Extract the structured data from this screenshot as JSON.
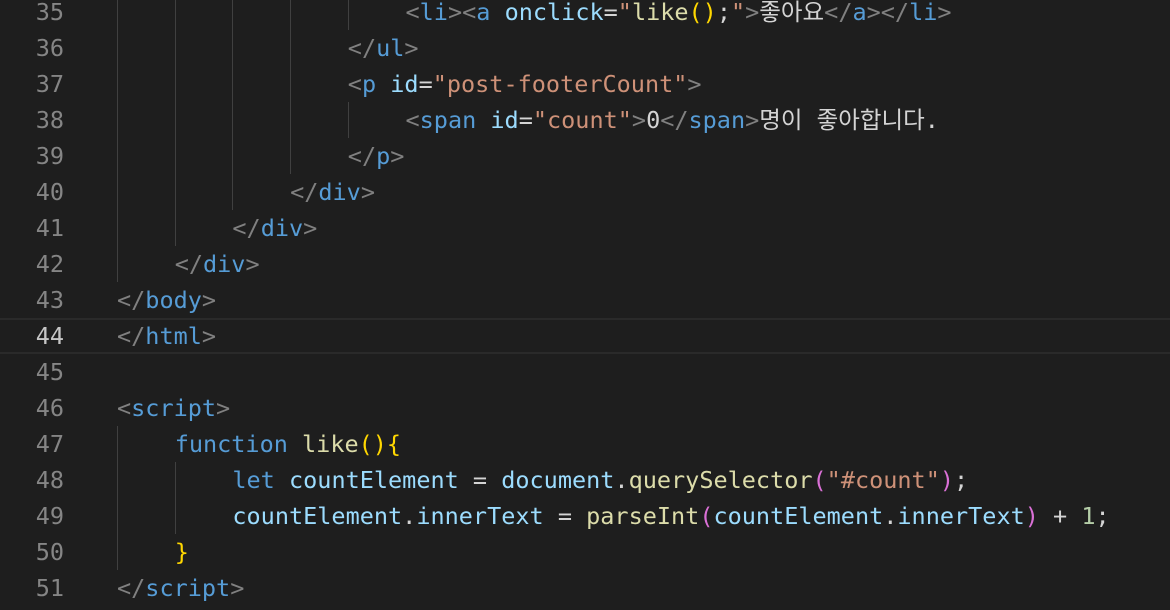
{
  "editor": {
    "current_line": 44,
    "lines": [
      {
        "n": "35",
        "indent": 5,
        "tokens": [
          [
            "<",
            "punc"
          ],
          [
            "li",
            "tag"
          ],
          [
            ">",
            "punc"
          ],
          [
            "<",
            "punc"
          ],
          [
            "a",
            "tag"
          ],
          [
            " ",
            "text"
          ],
          [
            "onclick",
            "attr"
          ],
          [
            "=",
            "text"
          ],
          [
            "\"",
            "str"
          ],
          [
            "like",
            "fn"
          ],
          [
            "()",
            "br1"
          ],
          [
            ";",
            "text"
          ],
          [
            "\"",
            "str"
          ],
          [
            ">",
            "punc"
          ],
          [
            "좋아요",
            "text"
          ],
          [
            "</",
            "punc"
          ],
          [
            "a",
            "tag"
          ],
          [
            ">",
            "punc"
          ],
          [
            "</",
            "punc"
          ],
          [
            "li",
            "tag"
          ],
          [
            ">",
            "punc"
          ]
        ]
      },
      {
        "n": "36",
        "indent": 4,
        "tokens": [
          [
            "</",
            "punc"
          ],
          [
            "ul",
            "tag"
          ],
          [
            ">",
            "punc"
          ]
        ]
      },
      {
        "n": "37",
        "indent": 4,
        "tokens": [
          [
            "<",
            "punc"
          ],
          [
            "p",
            "tag"
          ],
          [
            " ",
            "text"
          ],
          [
            "id",
            "attr"
          ],
          [
            "=",
            "text"
          ],
          [
            "\"post-footerCount\"",
            "str"
          ],
          [
            ">",
            "punc"
          ]
        ]
      },
      {
        "n": "38",
        "indent": 5,
        "tokens": [
          [
            "<",
            "punc"
          ],
          [
            "span",
            "tag"
          ],
          [
            " ",
            "text"
          ],
          [
            "id",
            "attr"
          ],
          [
            "=",
            "text"
          ],
          [
            "\"count\"",
            "str"
          ],
          [
            ">",
            "punc"
          ],
          [
            "0",
            "text"
          ],
          [
            "</",
            "punc"
          ],
          [
            "span",
            "tag"
          ],
          [
            ">",
            "punc"
          ],
          [
            "명이 좋아합니다.",
            "text"
          ]
        ]
      },
      {
        "n": "39",
        "indent": 4,
        "tokens": [
          [
            "</",
            "punc"
          ],
          [
            "p",
            "tag"
          ],
          [
            ">",
            "punc"
          ]
        ]
      },
      {
        "n": "40",
        "indent": 3,
        "tokens": [
          [
            "</",
            "punc"
          ],
          [
            "div",
            "tag"
          ],
          [
            ">",
            "punc"
          ]
        ]
      },
      {
        "n": "41",
        "indent": 2,
        "tokens": [
          [
            "</",
            "punc"
          ],
          [
            "div",
            "tag"
          ],
          [
            ">",
            "punc"
          ]
        ]
      },
      {
        "n": "42",
        "indent": 1,
        "tokens": [
          [
            "</",
            "punc"
          ],
          [
            "div",
            "tag"
          ],
          [
            ">",
            "punc"
          ]
        ]
      },
      {
        "n": "43",
        "indent": 0,
        "tokens": [
          [
            "</",
            "punc"
          ],
          [
            "body",
            "tag"
          ],
          [
            ">",
            "punc"
          ]
        ]
      },
      {
        "n": "44",
        "indent": 0,
        "tokens": [
          [
            "</",
            "punc"
          ],
          [
            "html",
            "tag"
          ],
          [
            ">",
            "punc"
          ]
        ]
      },
      {
        "n": "45",
        "indent": 0,
        "tokens": []
      },
      {
        "n": "46",
        "indent": 0,
        "tokens": [
          [
            "<",
            "punc"
          ],
          [
            "script",
            "tag"
          ],
          [
            ">",
            "punc"
          ]
        ]
      },
      {
        "n": "47",
        "indent": 1,
        "tokens": [
          [
            "function",
            "kw"
          ],
          [
            " ",
            "text"
          ],
          [
            "like",
            "fn"
          ],
          [
            "(){",
            "br1"
          ]
        ]
      },
      {
        "n": "48",
        "indent": 2,
        "tokens": [
          [
            "let",
            "kw"
          ],
          [
            " ",
            "text"
          ],
          [
            "countElement",
            "var"
          ],
          [
            " = ",
            "text"
          ],
          [
            "document",
            "var"
          ],
          [
            ".",
            "text"
          ],
          [
            "querySelector",
            "fn"
          ],
          [
            "(",
            "br2"
          ],
          [
            "\"#count\"",
            "str"
          ],
          [
            ")",
            "br2"
          ],
          [
            ";",
            "text"
          ]
        ]
      },
      {
        "n": "49",
        "indent": 2,
        "tokens": [
          [
            "countElement",
            "var"
          ],
          [
            ".",
            "text"
          ],
          [
            "innerText",
            "var"
          ],
          [
            " = ",
            "text"
          ],
          [
            "parseInt",
            "fn"
          ],
          [
            "(",
            "br2"
          ],
          [
            "countElement",
            "var"
          ],
          [
            ".",
            "text"
          ],
          [
            "innerText",
            "var"
          ],
          [
            ")",
            "br2"
          ],
          [
            " + ",
            "text"
          ],
          [
            "1",
            "num"
          ],
          [
            ";",
            "text"
          ]
        ]
      },
      {
        "n": "50",
        "indent": 1,
        "tokens": [
          [
            "}",
            "br1"
          ]
        ]
      },
      {
        "n": "51",
        "indent": 0,
        "tokens": [
          [
            "</",
            "punc"
          ],
          [
            "script",
            "tag"
          ],
          [
            ">",
            "punc"
          ]
        ]
      }
    ]
  },
  "colors": {
    "background": "#1e1e1e",
    "tag": "#569cd6",
    "attribute": "#9cdcfe",
    "string": "#ce9178",
    "function": "#dcdcaa",
    "bracket_level1": "#ffd700",
    "bracket_level2": "#da70d6",
    "number": "#b5cea8"
  }
}
